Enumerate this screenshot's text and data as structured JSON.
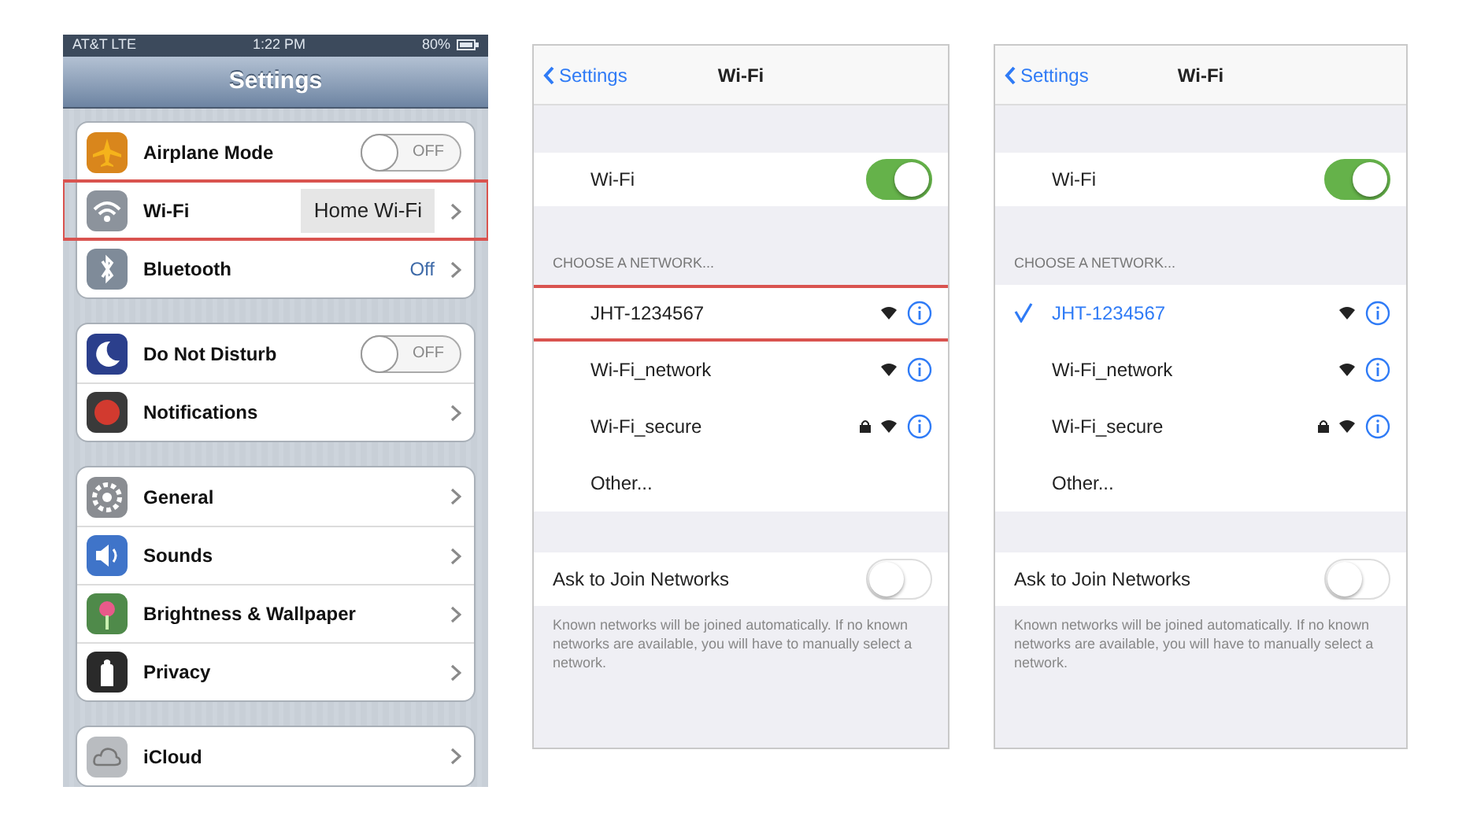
{
  "screens": [
    {
      "kind": "settings",
      "status_bar": {
        "carrier": "AT&T LTE",
        "time": "1:22 PM",
        "battery": "80%"
      },
      "title": "Settings",
      "groups": [
        [
          {
            "kind": "toggle",
            "label": "Airplane Mode",
            "color": "#d9861c",
            "on": false,
            "toggle_text": "OFF",
            "highlighted": false
          },
          {
            "kind": "link",
            "label": "Wi-Fi",
            "color": "#8c939c",
            "value": "Home Wi-Fi",
            "highlighted": true
          },
          {
            "kind": "link",
            "label": "Bluetooth",
            "color": "#7f8b99",
            "value": "Off",
            "highlighted": false
          }
        ],
        [
          {
            "kind": "toggle",
            "label": "Do Not Disturb",
            "color": "#2b3f8c",
            "on": false,
            "toggle_text": "OFF",
            "highlighted": false
          },
          {
            "kind": "link",
            "label": "Notifications",
            "color": "#3a3a3a",
            "highlighted": false
          }
        ],
        [
          {
            "kind": "link",
            "label": "General",
            "color": "#8a8d92",
            "highlighted": false
          },
          {
            "kind": "link",
            "label": "Sounds",
            "color": "#3f74c9",
            "highlighted": false
          },
          {
            "kind": "link",
            "label": "Brightness & Wallpaper",
            "color": "#4f8a4a",
            "highlighted": false
          },
          {
            "kind": "link",
            "label": "Privacy",
            "color": "#2a2a2a",
            "highlighted": false
          }
        ],
        [
          {
            "kind": "link",
            "label": "iCloud",
            "color": "#b9bcc0",
            "highlighted": false
          }
        ]
      ]
    },
    {
      "kind": "wifi",
      "back": "Settings",
      "title": "Wi-Fi",
      "wifi": {
        "label": "Wi-Fi",
        "on": true
      },
      "section": "CHOOSE A NETWORK...",
      "networks": [
        {
          "name": "JHT-1234567",
          "selected": false,
          "locked": false,
          "highlighted": true
        },
        {
          "name": "Wi-Fi_network",
          "selected": false,
          "locked": false,
          "highlighted": false
        },
        {
          "name": "Wi-Fi_secure",
          "selected": false,
          "locked": true,
          "highlighted": false
        }
      ],
      "other": "Other...",
      "ask": {
        "label": "Ask to Join Networks",
        "on": false
      },
      "footnote": "Known networks will be joined automatically. If no known networks are available, you will have to manually select a network."
    },
    {
      "kind": "wifi",
      "back": "Settings",
      "title": "Wi-Fi",
      "wifi": {
        "label": "Wi-Fi",
        "on": true
      },
      "section": "CHOOSE A NETWORK...",
      "networks": [
        {
          "name": "JHT-1234567",
          "selected": true,
          "locked": false,
          "highlighted": false
        },
        {
          "name": "Wi-Fi_network",
          "selected": false,
          "locked": false,
          "highlighted": false
        },
        {
          "name": "Wi-Fi_secure",
          "selected": false,
          "locked": true,
          "highlighted": false
        }
      ],
      "other": "Other...",
      "ask": {
        "label": "Ask to Join Networks",
        "on": false
      },
      "footnote": "Known networks will be joined automatically. If no known networks are available, you will have to manually select a network."
    }
  ]
}
